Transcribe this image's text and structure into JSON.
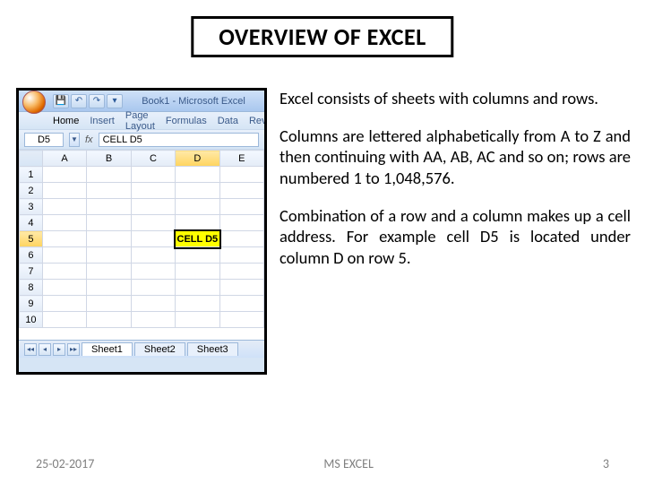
{
  "title": "OVERVIEW OF EXCEL",
  "excel": {
    "window_title": "Book1 - Microsoft Excel",
    "qat": {
      "save": "💾",
      "undo": "↶",
      "redo": "↷",
      "dd": "▾"
    },
    "tabs": [
      "Home",
      "Insert",
      "Page Layout",
      "Formulas",
      "Data",
      "Rev"
    ],
    "name_box": "D5",
    "fx_label": "fx",
    "formula": "CELL D5",
    "columns": [
      "A",
      "B",
      "C",
      "D",
      "E"
    ],
    "rows": [
      "1",
      "2",
      "3",
      "4",
      "5",
      "6",
      "7",
      "8",
      "9",
      "10"
    ],
    "selected_cell_value": "CELL D5",
    "nav": {
      "first": "◂◂",
      "prev": "◂",
      "next": "▸",
      "last": "▸▸"
    },
    "sheet_tabs": [
      "Sheet1",
      "Sheet2",
      "Sheet3"
    ]
  },
  "paragraphs": {
    "p1": "Excel consists of sheets with columns and rows.",
    "p2": "Columns are lettered alphabetically from A to Z and then continuing with AA, AB, AC and so on; rows are numbered 1 to 1,048,576.",
    "p3": "Combination of a row and a column makes up a cell address. For example cell D5 is located under column D on row 5."
  },
  "footer": {
    "date": "25-02-2017",
    "center": "MS EXCEL",
    "page": "3"
  }
}
